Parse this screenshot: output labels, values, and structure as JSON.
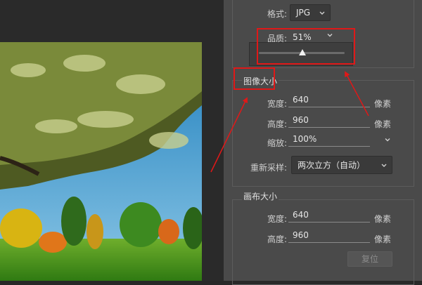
{
  "format": {
    "label": "格式:",
    "value": "JPG"
  },
  "quality": {
    "label": "品质:",
    "value": "51%",
    "level": 0.51
  },
  "image_size": {
    "title": "图像大小",
    "width_label": "宽度:",
    "width_value": "640",
    "width_unit": "像素",
    "height_label": "高度:",
    "height_value": "960",
    "height_unit": "像素",
    "scale_label": "缩放:",
    "scale_value": "100%",
    "resample_label": "重新采样:",
    "resample_value": "两次立方（自动）"
  },
  "canvas_size": {
    "title": "画布大小",
    "width_label": "宽度:",
    "width_value": "640",
    "width_unit": "像素",
    "height_label": "高度:",
    "height_value": "960",
    "height_unit": "像素"
  },
  "reset_label": "复位",
  "colors": {
    "panel": "#4a4a4a",
    "annotation": "#e01818"
  }
}
